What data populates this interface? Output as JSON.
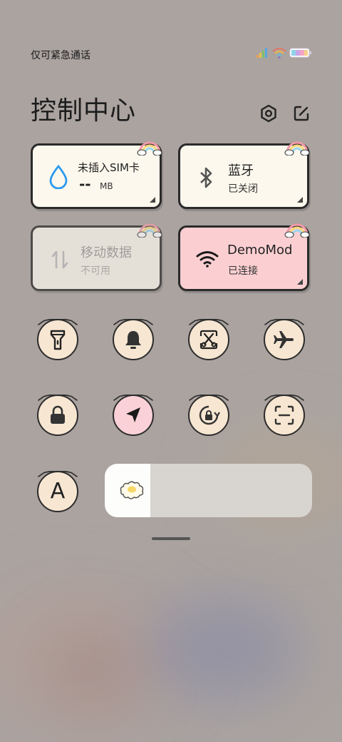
{
  "status_bar": {
    "text": "仅可紧急通话",
    "icons": [
      "signal-icon",
      "wifi-icon",
      "battery-icon"
    ]
  },
  "header": {
    "title": "控制中心",
    "settings_icon": "gear-icon",
    "edit_icon": "edit-icon"
  },
  "cards": {
    "mobile_data_usage": {
      "title": "未插入SIM卡",
      "value": "--",
      "unit": "MB",
      "icon": "water-drop-icon"
    },
    "bluetooth": {
      "title": "蓝牙",
      "status": "已关闭",
      "icon": "bluetooth-icon"
    },
    "mobile_data": {
      "title": "移动数据",
      "status": "不可用",
      "icon": "data-arrows-icon"
    },
    "wifi": {
      "title": "DemoMod",
      "status": "已连接",
      "icon": "wifi-icon"
    }
  },
  "toggles": [
    {
      "icon": "flashlight-icon",
      "active": false
    },
    {
      "icon": "bell-icon",
      "active": false
    },
    {
      "icon": "screenshot-icon",
      "active": false
    },
    {
      "icon": "airplane-icon",
      "active": false
    },
    {
      "icon": "lock-icon",
      "active": false
    },
    {
      "icon": "location-icon",
      "active": true
    },
    {
      "icon": "rotation-lock-icon",
      "active": false
    },
    {
      "icon": "scan-icon",
      "active": false
    },
    {
      "icon": "font-icon",
      "label": "A",
      "active": false
    }
  ],
  "brightness": {
    "level": 0.22,
    "icon": "sun-icon"
  },
  "colors": {
    "accent_pink": "#fbcfd2",
    "card_bg": "#fdf8ed",
    "outline": "#2a2a2a",
    "water_blue": "#2a9af0"
  }
}
